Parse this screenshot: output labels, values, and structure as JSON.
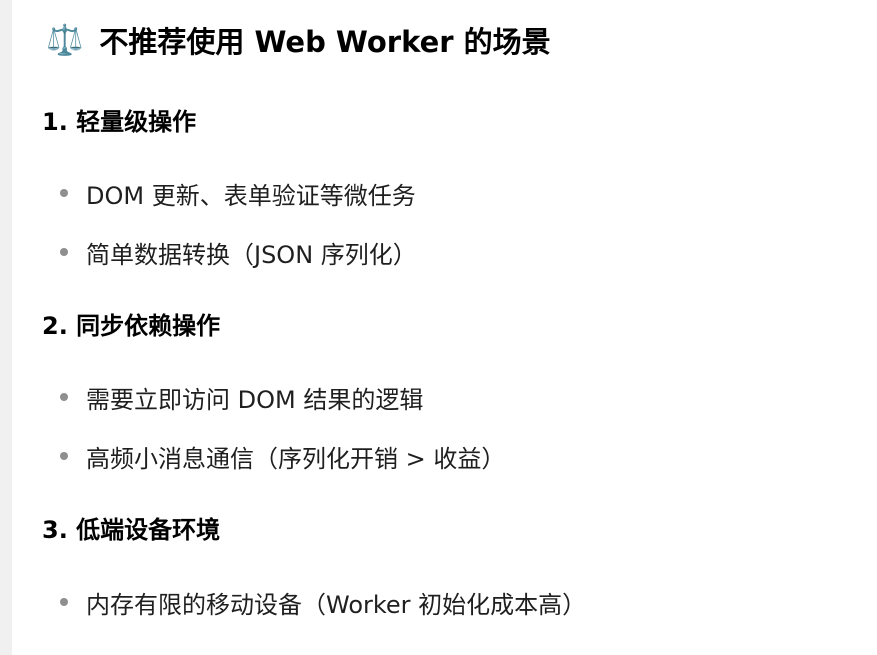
{
  "title": {
    "icon": "⚖️",
    "text": "不推荐使用 Web Worker 的场景"
  },
  "sections": [
    {
      "heading": "1. 轻量级操作",
      "items": [
        "DOM 更新、表单验证等微任务",
        "简单数据转换（JSON 序列化）"
      ]
    },
    {
      "heading": "2. 同步依赖操作",
      "items": [
        "需要立即访问 DOM 结果的逻辑",
        "高频小消息通信（序列化开销 > 收益）"
      ]
    },
    {
      "heading": "3. 低端设备环境",
      "items": [
        "内存有限的移动设备（Worker 初始化成本高）"
      ]
    }
  ],
  "icons": {
    "title_icon": "balance-scale-icon"
  },
  "colors": {
    "bullet": "#8f8f8f",
    "icon": "#e0a300"
  }
}
